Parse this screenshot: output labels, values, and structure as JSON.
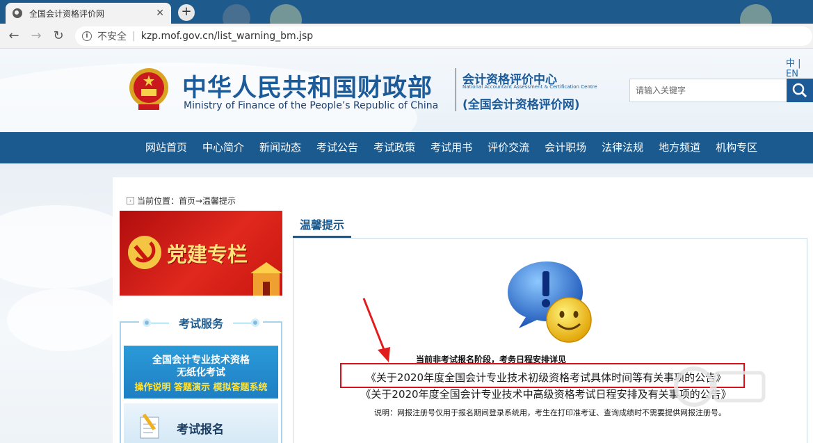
{
  "browser": {
    "tab_title": "全国会计资格评价网",
    "tab_close": "✕",
    "new_tab": "+",
    "security_label": "不安全",
    "url": "kzp.mof.gov.cn/list_warning_bm.jsp"
  },
  "header": {
    "lang_zh": "中",
    "lang_sep": "|",
    "lang_en": "EN",
    "title_cn": "中华人民共和国财政部",
    "title_en": "Ministry of Finance of the People’s Republic of China",
    "center_cn": "会计资格评价中心",
    "center_en": "National Accountant Assessment & Certification Centre",
    "center_sub": "(全国会计资格评价网)",
    "search_placeholder": "请输入关键字"
  },
  "nav": {
    "items": [
      "网站首页",
      "中心简介",
      "新闻动态",
      "考试公告",
      "考试政策",
      "考试用书",
      "评价交流",
      "会计职场",
      "法律法规",
      "地方频道",
      "机构专区"
    ]
  },
  "breadcrumb": "当前位置：首页→温馨提示",
  "sidebar": {
    "party_banner": "党建专栏",
    "exam_service_title": "考试服务",
    "paperless_line1": "全国会计专业技术资格",
    "paperless_line2": "无纸化考试",
    "paperless_line3": "操作说明 答题演示 模拟答题系统",
    "signup_label": "考试报名"
  },
  "main": {
    "tab_label": "温馨提示",
    "notice": "当前非考试报名阶段，考务日程安排详见",
    "link1": "《关于2020年度全国会计专业技术初级资格考试具体时间等有关事项的公告》",
    "link2": "《关于2020年度全国会计专业技术中高级资格考试日程安排及有关事项的公告》",
    "note": "说明：网报注册号仅用于报名期间登录系统用，考生在打印准考证、查询成绩时不需要提供网报注册号。"
  },
  "colors": {
    "nav_blue": "#1b5a8e",
    "highlight_red": "#d8101a",
    "party_red": "#d01e1e"
  }
}
